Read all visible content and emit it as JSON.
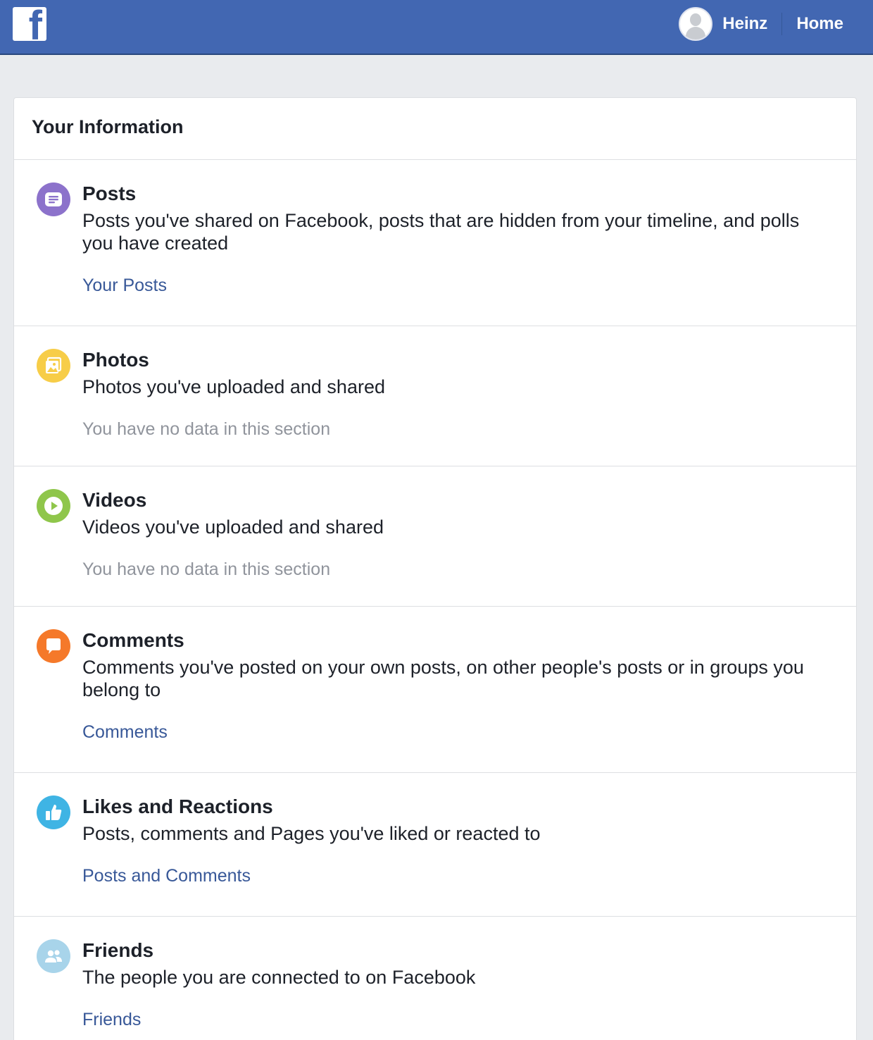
{
  "header": {
    "brand_icon": "facebook-f-logo",
    "brand_letter": "f",
    "user_name": "Heinz",
    "home_label": "Home",
    "bar_color": "#4267b2"
  },
  "card": {
    "title": "Your Information",
    "sections": [
      {
        "icon": "posts-icon",
        "icon_color": "#8c72cb",
        "title": "Posts",
        "description": "Posts you've shared on Facebook, posts that are hidden from your timeline, and polls you have created",
        "link": "Your Posts",
        "empty": ""
      },
      {
        "icon": "photos-icon",
        "icon_color": "#f7cd48",
        "title": "Photos",
        "description": "Photos you've uploaded and shared",
        "link": "",
        "empty": "You have no data in this section"
      },
      {
        "icon": "videos-icon",
        "icon_color": "#8fc64b",
        "title": "Videos",
        "description": "Videos you've uploaded and shared",
        "link": "",
        "empty": "You have no data in this section"
      },
      {
        "icon": "comments-icon",
        "icon_color": "#f5792a",
        "title": "Comments",
        "description": "Comments you've posted on your own posts, on other people's posts or in groups you belong to",
        "link": "Comments",
        "empty": ""
      },
      {
        "icon": "likes-icon",
        "icon_color": "#3fb4e4",
        "title": "Likes and Reactions",
        "description": "Posts, comments and Pages you've liked or reacted to",
        "link": "Posts and Comments",
        "empty": ""
      },
      {
        "icon": "friends-icon",
        "icon_color": "#a8d4ea",
        "title": "Friends",
        "description": "The people you are connected to on Facebook",
        "link": "Friends",
        "empty": ""
      }
    ]
  }
}
